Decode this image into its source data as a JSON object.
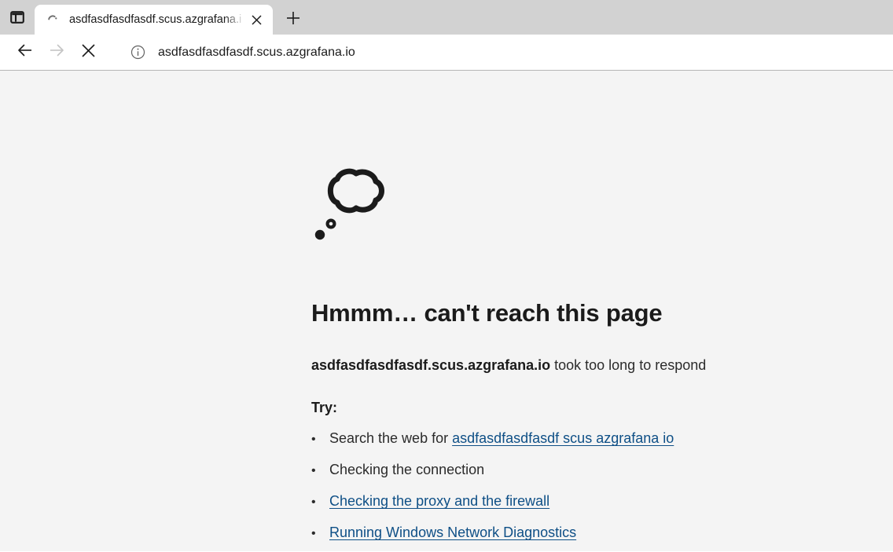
{
  "browser": {
    "tab_list_icon": "tab-list-icon",
    "tab": {
      "favicon": "loading-favicon",
      "title": "asdfasdfasdfasdf.scus.azgrafana.i",
      "close_icon": "close-icon"
    },
    "new_tab_icon": "plus-icon",
    "toolbar": {
      "back_icon": "back-arrow-icon",
      "forward_icon": "forward-arrow-icon",
      "stop_icon": "stop-close-icon",
      "info_icon": "info-circle-icon",
      "url": "asdfasdfasdfasdf.scus.azgrafana.io"
    }
  },
  "error_page": {
    "illustration": "thought-bubble-icon",
    "headline": "Hmmm… can't reach this page",
    "subtitle_host": "asdfasdfasdfasdf.scus.azgrafana.io",
    "subtitle_rest": " took too long to respond",
    "try_label": "Try:",
    "items": [
      {
        "prefix": "Search the web for ",
        "link": "asdfasdfasdfasdf scus azgrafana io",
        "is_link": true
      },
      {
        "prefix": "Checking the connection",
        "link": "",
        "is_link": false
      },
      {
        "prefix": "",
        "link": "Checking the proxy and the firewall",
        "is_link": true
      },
      {
        "prefix": "",
        "link": "Running Windows Network Diagnostics",
        "is_link": true
      }
    ]
  },
  "colors": {
    "titlebar": "#d2d2d2",
    "page_bg": "#f4f4f4",
    "link": "#0e4f86",
    "text": "#1b1b1b"
  }
}
